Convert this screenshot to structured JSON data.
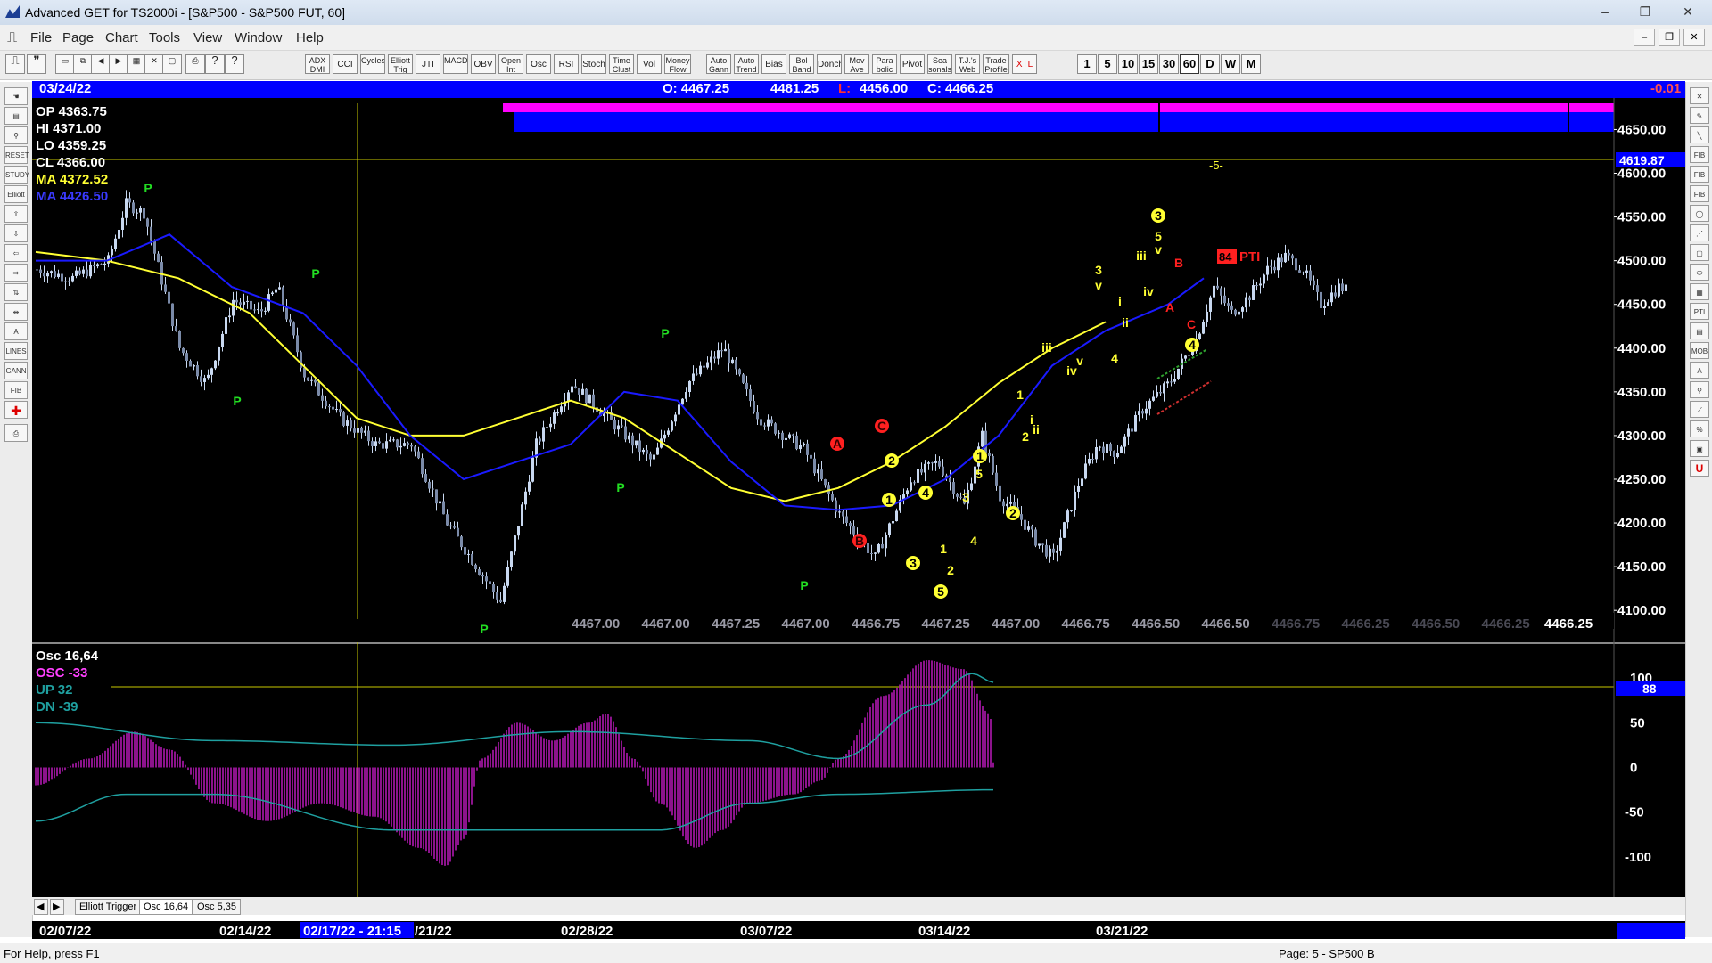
{
  "window": {
    "title": "Advanced GET for TS2000i - [S&P500 - S&P500 FUT, 60]",
    "controls": [
      "–",
      "❐",
      "✕"
    ],
    "mdi_controls": [
      "–",
      "❐",
      "✕"
    ]
  },
  "menu": [
    "File",
    "Page",
    "Chart",
    "Tools",
    "View",
    "Window",
    "Help"
  ],
  "toolbar": {
    "indicators": [
      "ADX DMI",
      "CCI",
      "Cycles",
      "Elliott Trig",
      "JTI",
      "MACD",
      "OBV",
      "Open Int",
      "Osc",
      "RSI",
      "Stoch",
      "Time Clust",
      "Vol",
      "Money Flow",
      "Auto Gann",
      "Auto Trend",
      "Bias",
      "Bol Band",
      "Donch",
      "Mov Ave",
      "Para bolic",
      "Pivot",
      "Sea sonals",
      "T.J.'s Web",
      "Trade Profile",
      "XTL"
    ],
    "timeframes": [
      "1",
      "5",
      "10",
      "15",
      "30",
      "60",
      "D",
      "W",
      "M"
    ]
  },
  "header": {
    "date": "03/24/22",
    "open": "O: 4467.25",
    "high": "4481.25",
    "low_label": "L:",
    "low": "4456.00",
    "close": "C: 4466.25",
    "change": "-0.01"
  },
  "legend": {
    "op": "OP  4363.75",
    "hi": "HI   4371.00",
    "lo": "LO  4359.25",
    "cl": "CL  4366.00",
    "ma1": "MA  4372.52",
    "ma2": "MA  4426.50"
  },
  "price_axis": [
    "4650.00",
    "4600.00",
    "4550.00",
    "4500.00",
    "4450.00",
    "4400.00",
    "4350.00",
    "4300.00",
    "4250.00",
    "4200.00",
    "4150.00",
    "4100.00"
  ],
  "price_marker": "4619.87",
  "bottom_values": [
    "4467.00",
    "4467.00",
    "4467.25",
    "4467.00",
    "4466.75",
    "4467.25",
    "4467.00",
    "4466.75",
    "4466.50",
    "4466.50",
    "4466.75",
    "4466.25",
    "4466.50",
    "4466.25"
  ],
  "bottom_last": "4466.25",
  "pti": {
    "value": "84",
    "label": "PTI"
  },
  "wave5_label": "-5-",
  "osc": {
    "title": "Osc 16,64",
    "osc": "OSC -33",
    "up": "UP   32",
    "dn": "DN   -39",
    "axis": [
      "100",
      "50",
      "0",
      "-50",
      "-100"
    ],
    "marker": "88"
  },
  "tabs": [
    "Elliott Trigger",
    "Osc 16,64",
    "Osc 5,35"
  ],
  "dates": [
    "02/07/22",
    "02/14/22",
    "02/17/22 - 21:15",
    "/21/22",
    "02/28/22",
    "03/07/22",
    "03/14/22",
    "03/21/22"
  ],
  "status": {
    "left": "For Help, press F1",
    "right": "Page: 5 - SP500 B"
  },
  "colors": {
    "up_bar": "#c8d8f0",
    "ma_fast": "#ffff33",
    "ma_slow": "#1a1aff",
    "osc": "#c020c0",
    "band": "#1fa0a0",
    "blue_bar": "#0000ff"
  },
  "chart_data": {
    "type": "candlestick",
    "ylim": [
      4090,
      4680
    ],
    "osc_ylim": [
      -135,
      130
    ],
    "x_dates": [
      "02/07/22",
      "02/14/22",
      "02/21/22",
      "02/28/22",
      "03/07/22",
      "03/14/22",
      "03/21/22"
    ],
    "price_path": [
      [
        0,
        4490
      ],
      [
        40,
        4480
      ],
      [
        80,
        4500
      ],
      [
        100,
        4565
      ],
      [
        120,
        4555
      ],
      [
        160,
        4400
      ],
      [
        190,
        4360
      ],
      [
        220,
        4455
      ],
      [
        250,
        4440
      ],
      [
        270,
        4470
      ],
      [
        300,
        4370
      ],
      [
        340,
        4320
      ],
      [
        380,
        4290
      ],
      [
        420,
        4290
      ],
      [
        460,
        4200
      ],
      [
        520,
        4110
      ],
      [
        560,
        4290
      ],
      [
        600,
        4360
      ],
      [
        640,
        4320
      ],
      [
        690,
        4270
      ],
      [
        730,
        4360
      ],
      [
        770,
        4400
      ],
      [
        810,
        4320
      ],
      [
        860,
        4285
      ],
      [
        900,
        4210
      ],
      [
        940,
        4160
      ],
      [
        980,
        4250
      ],
      [
        1010,
        4270
      ],
      [
        1040,
        4220
      ],
      [
        1060,
        4300
      ],
      [
        1080,
        4230
      ],
      [
        1100,
        4210
      ],
      [
        1120,
        4180
      ],
      [
        1140,
        4160
      ],
      [
        1170,
        4250
      ],
      [
        1190,
        4290
      ],
      [
        1210,
        4280
      ],
      [
        1240,
        4330
      ],
      [
        1270,
        4360
      ],
      [
        1300,
        4410
      ],
      [
        1320,
        4470
      ],
      [
        1340,
        4440
      ],
      [
        1360,
        4460
      ],
      [
        1380,
        4490
      ],
      [
        1400,
        4505
      ],
      [
        1420,
        4490
      ],
      [
        1440,
        4450
      ],
      [
        1460,
        4470
      ],
      [
        1470,
        4466
      ]
    ],
    "ma_fast_path": [
      [
        0,
        4510
      ],
      [
        80,
        4500
      ],
      [
        160,
        4480
      ],
      [
        240,
        4440
      ],
      [
        300,
        4380
      ],
      [
        360,
        4320
      ],
      [
        420,
        4300
      ],
      [
        480,
        4300
      ],
      [
        540,
        4320
      ],
      [
        600,
        4340
      ],
      [
        660,
        4320
      ],
      [
        720,
        4280
      ],
      [
        780,
        4240
      ],
      [
        840,
        4225
      ],
      [
        900,
        4240
      ],
      [
        960,
        4270
      ],
      [
        1020,
        4310
      ],
      [
        1080,
        4360
      ],
      [
        1140,
        4400
      ],
      [
        1200,
        4430
      ]
    ],
    "ma_slow_path": [
      [
        0,
        4500
      ],
      [
        80,
        4500
      ],
      [
        150,
        4530
      ],
      [
        220,
        4470
      ],
      [
        300,
        4440
      ],
      [
        360,
        4380
      ],
      [
        420,
        4300
      ],
      [
        480,
        4250
      ],
      [
        540,
        4270
      ],
      [
        600,
        4290
      ],
      [
        660,
        4350
      ],
      [
        720,
        4340
      ],
      [
        780,
        4270
      ],
      [
        840,
        4220
      ],
      [
        900,
        4215
      ],
      [
        960,
        4220
      ],
      [
        1020,
        4250
      ],
      [
        1080,
        4300
      ],
      [
        1140,
        4380
      ],
      [
        1200,
        4420
      ],
      [
        1270,
        4450
      ],
      [
        1310,
        4480
      ]
    ],
    "osc_hist": [
      [
        0,
        -20
      ],
      [
        60,
        10
      ],
      [
        110,
        40
      ],
      [
        150,
        20
      ],
      [
        200,
        -40
      ],
      [
        260,
        -60
      ],
      [
        320,
        -40
      ],
      [
        380,
        -55
      ],
      [
        430,
        -90
      ],
      [
        460,
        -110
      ],
      [
        480,
        -80
      ],
      [
        500,
        10
      ],
      [
        540,
        50
      ],
      [
        580,
        30
      ],
      [
        620,
        50
      ],
      [
        640,
        60
      ],
      [
        670,
        10
      ],
      [
        700,
        -40
      ],
      [
        740,
        -90
      ],
      [
        770,
        -70
      ],
      [
        800,
        -40
      ],
      [
        850,
        -30
      ],
      [
        880,
        -15
      ],
      [
        900,
        10
      ],
      [
        950,
        80
      ],
      [
        1000,
        120
      ],
      [
        1040,
        110
      ],
      [
        1070,
        60
      ],
      [
        1075,
        0
      ]
    ],
    "osc_upper_path": [
      [
        0,
        50
      ],
      [
        200,
        30
      ],
      [
        400,
        25
      ],
      [
        600,
        40
      ],
      [
        800,
        30
      ],
      [
        900,
        10
      ],
      [
        1000,
        70
      ],
      [
        1050,
        105
      ],
      [
        1075,
        95
      ]
    ],
    "osc_lower_path": [
      [
        0,
        -60
      ],
      [
        100,
        -30
      ],
      [
        200,
        -30
      ],
      [
        400,
        -70
      ],
      [
        500,
        -70
      ],
      [
        700,
        -70
      ],
      [
        800,
        -40
      ],
      [
        900,
        -30
      ],
      [
        1075,
        -25
      ]
    ]
  }
}
